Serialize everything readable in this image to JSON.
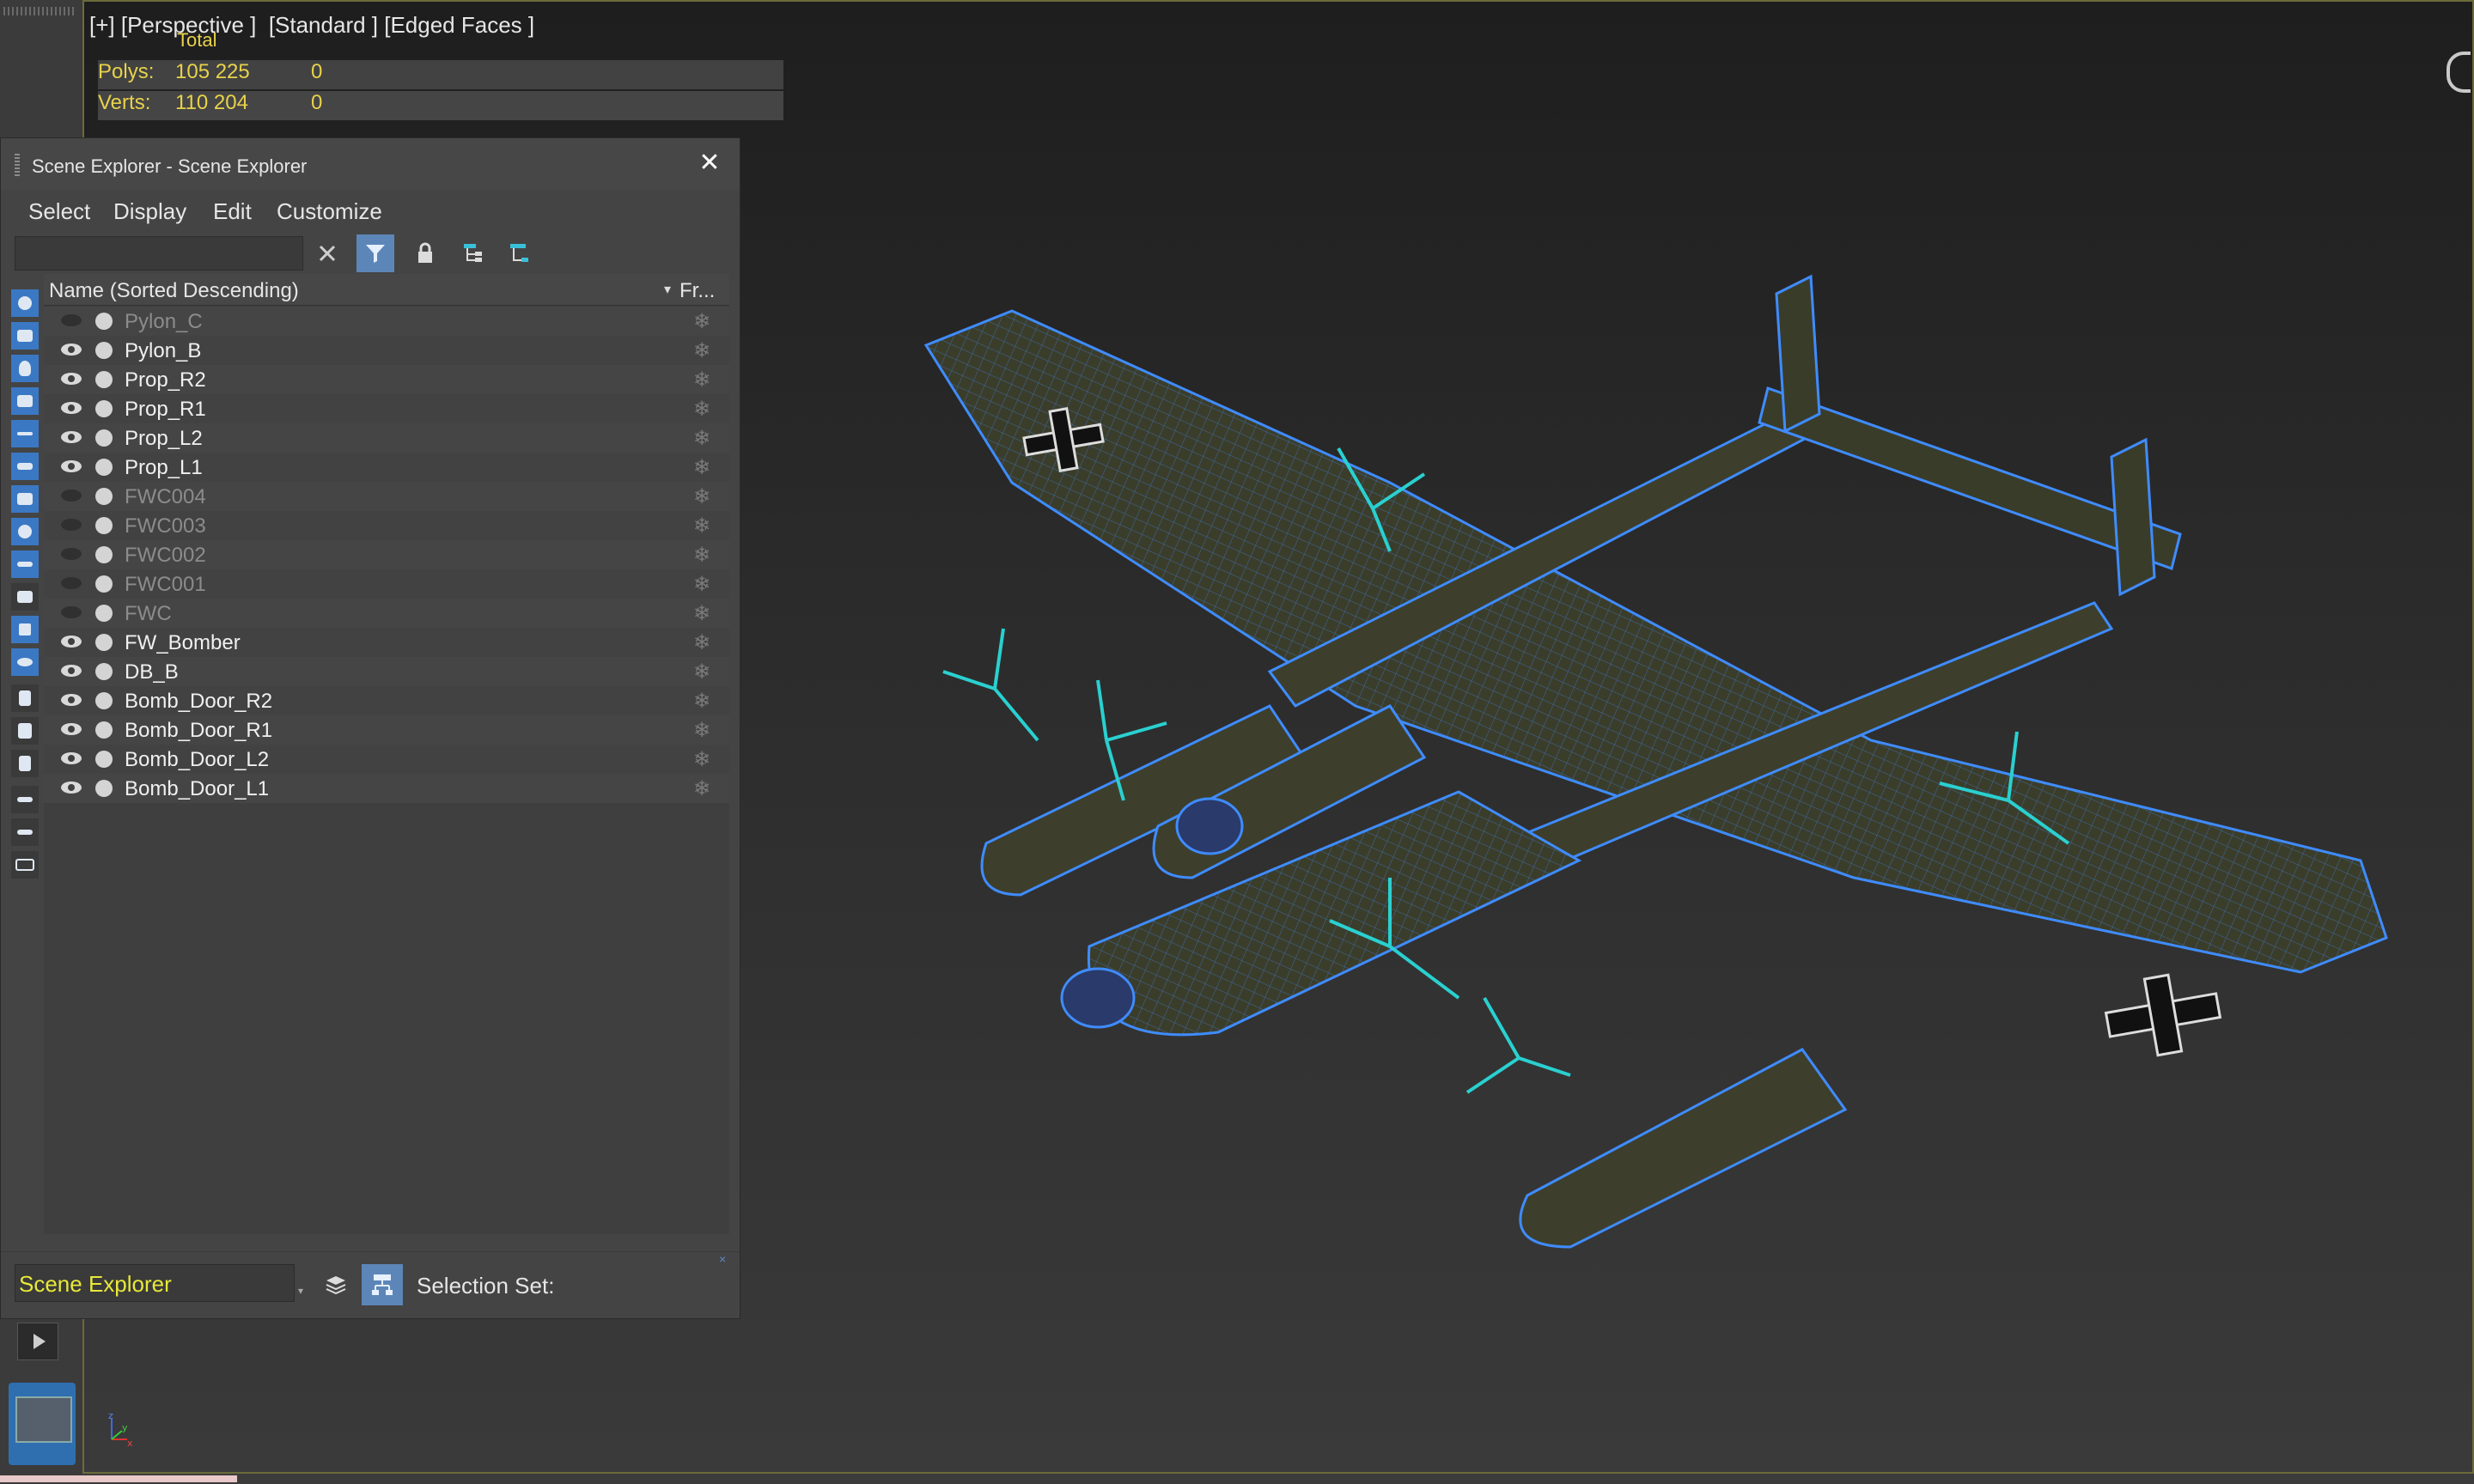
{
  "viewport": {
    "label": "[+] [Perspective ]  [Standard ] [Edged Faces ]",
    "stats": {
      "total_label": "Total",
      "polys_label": "Polys:",
      "polys_value": "105 225",
      "polys_sel": "0",
      "verts_label": "Verts:",
      "verts_value": "110 204",
      "verts_sel": "0"
    },
    "axes": {
      "x": "x",
      "y": "y",
      "z": "z"
    }
  },
  "explorer": {
    "title": "Scene Explorer - Scene Explorer",
    "close_glyph": "✕",
    "menu": [
      "Select",
      "Display",
      "Edit",
      "Customize"
    ],
    "search_value": "",
    "column_name": "Name (Sorted Descending)",
    "column_sort_glyph": "▾",
    "column_frozen": "Fr...",
    "rows": [
      {
        "name": "Pylon_C",
        "visible": false
      },
      {
        "name": "Pylon_B",
        "visible": true
      },
      {
        "name": "Prop_R2",
        "visible": true
      },
      {
        "name": "Prop_R1",
        "visible": true
      },
      {
        "name": "Prop_L2",
        "visible": true
      },
      {
        "name": "Prop_L1",
        "visible": true
      },
      {
        "name": "FWC004",
        "visible": false
      },
      {
        "name": "FWC003",
        "visible": false
      },
      {
        "name": "FWC002",
        "visible": false
      },
      {
        "name": "FWC001",
        "visible": false
      },
      {
        "name": "FWC",
        "visible": false
      },
      {
        "name": "FW_Bomber",
        "visible": true
      },
      {
        "name": "DB_B",
        "visible": true
      },
      {
        "name": "Bomb_Door_R2",
        "visible": true
      },
      {
        "name": "Bomb_Door_R1",
        "visible": true
      },
      {
        "name": "Bomb_Door_L2",
        "visible": true
      },
      {
        "name": "Bomb_Door_L1",
        "visible": true
      }
    ],
    "frozen_glyph": "❄",
    "footer": {
      "explorer_name": "Scene Explorer",
      "selection_set_label": "Selection Set:",
      "mini_close": "×"
    }
  },
  "colors": {
    "accent_blue": "#5d86b8",
    "stats_yellow": "#e8d24a",
    "wire_blue": "#3f8cff",
    "olive": "#3d3f2c"
  }
}
